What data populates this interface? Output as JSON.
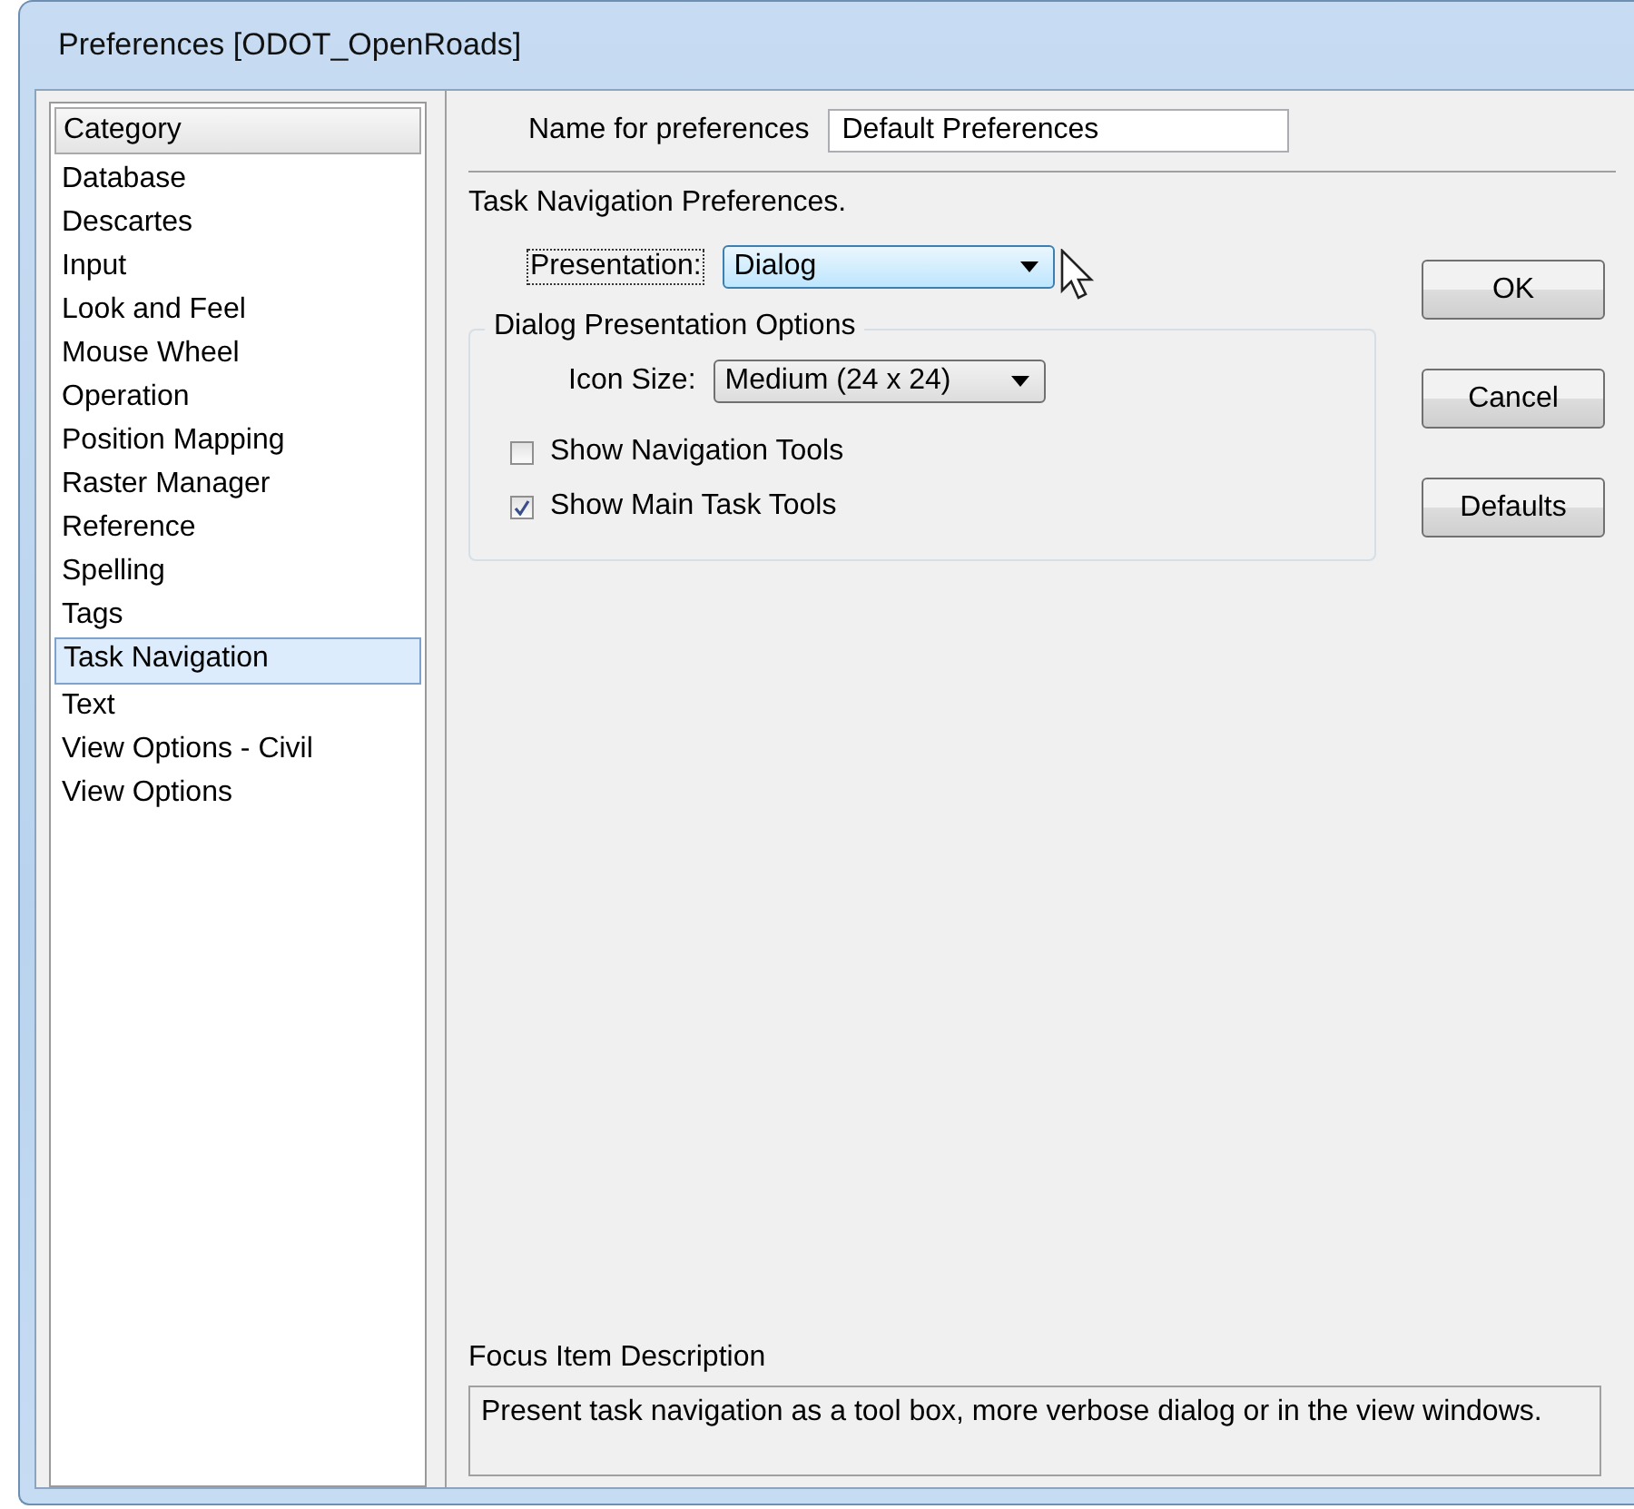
{
  "window": {
    "title": "Preferences [ODOT_OpenRoads]"
  },
  "category_list": {
    "header": "Category",
    "items": [
      {
        "label": "Database",
        "selected": false
      },
      {
        "label": "Descartes",
        "selected": false
      },
      {
        "label": "Input",
        "selected": false
      },
      {
        "label": "Look and Feel",
        "selected": false
      },
      {
        "label": "Mouse Wheel",
        "selected": false
      },
      {
        "label": "Operation",
        "selected": false
      },
      {
        "label": "Position Mapping",
        "selected": false
      },
      {
        "label": "Raster Manager",
        "selected": false
      },
      {
        "label": "Reference",
        "selected": false
      },
      {
        "label": "Spelling",
        "selected": false
      },
      {
        "label": "Tags",
        "selected": false
      },
      {
        "label": "Task Navigation",
        "selected": true
      },
      {
        "label": "Text",
        "selected": false
      },
      {
        "label": "View Options - Civil",
        "selected": false
      },
      {
        "label": "View Options",
        "selected": false
      }
    ]
  },
  "name_field": {
    "label": "Name for preferences",
    "value": "Default Preferences"
  },
  "section_title": "Task Navigation Preferences.",
  "presentation": {
    "label": "Presentation:",
    "value": "Dialog"
  },
  "options_group": {
    "title": "Dialog Presentation Options",
    "icon_size": {
      "label": "Icon Size:",
      "value": "Medium (24 x 24)"
    },
    "checkboxes": [
      {
        "label": "Show Navigation Tools",
        "checked": false
      },
      {
        "label": "Show Main Task Tools",
        "checked": true
      }
    ]
  },
  "buttons": [
    "OK",
    "Cancel",
    "Defaults"
  ],
  "focus_description": {
    "label": "Focus Item Description",
    "text": "Present task navigation as a tool box, more verbose dialog or in the view windows."
  }
}
